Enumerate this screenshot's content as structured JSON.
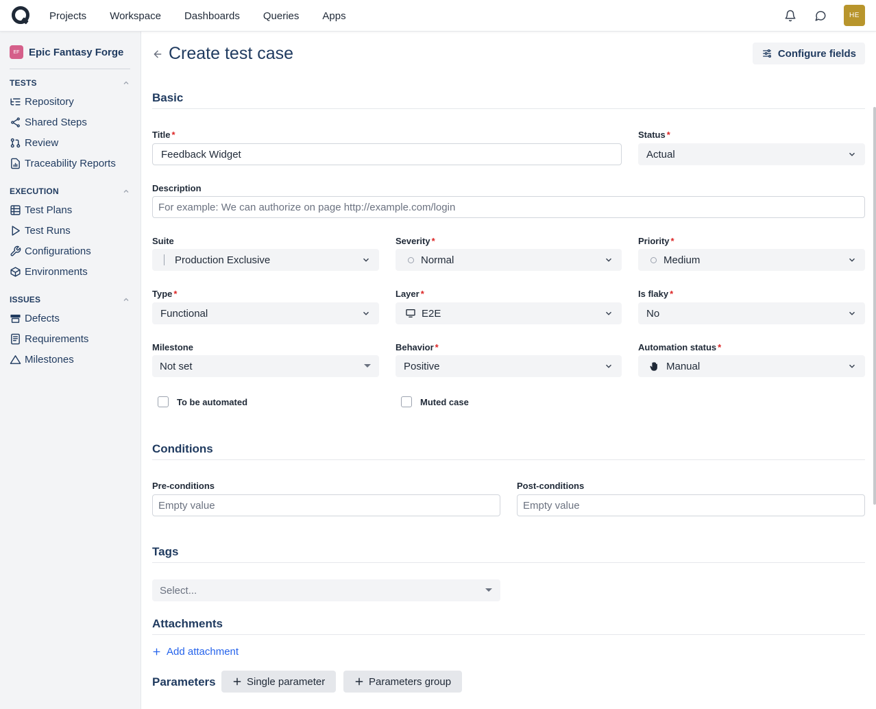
{
  "topnav": {
    "links": [
      "Projects",
      "Workspace",
      "Dashboards",
      "Queries",
      "Apps"
    ],
    "avatar_initials": "HE",
    "icons": [
      "bell-icon",
      "chat-icon"
    ]
  },
  "sidebar": {
    "project": {
      "badge": "EF",
      "name": "Epic Fantasy Forge"
    },
    "sections": [
      {
        "title": "TESTS",
        "items": [
          "Repository",
          "Shared Steps",
          "Review",
          "Traceability Reports"
        ]
      },
      {
        "title": "EXECUTION",
        "items": [
          "Test Plans",
          "Test Runs",
          "Configurations",
          "Environments"
        ]
      },
      {
        "title": "ISSUES",
        "items": [
          "Defects",
          "Requirements",
          "Milestones"
        ]
      }
    ]
  },
  "page": {
    "title": "Create test case",
    "configure_label": "Configure fields"
  },
  "basic": {
    "section": "Basic",
    "title_label": "Title",
    "title_value": "Feedback Widget",
    "status_label": "Status",
    "status_value": "Actual",
    "description_label": "Description",
    "description_placeholder": "For example: We can authorize on page http://example.com/login",
    "suite_label": "Suite",
    "suite_value": "Production Exclusive",
    "severity_label": "Severity",
    "severity_value": "Normal",
    "priority_label": "Priority",
    "priority_value": "Medium",
    "type_label": "Type",
    "type_value": "Functional",
    "layer_label": "Layer",
    "layer_value": "E2E",
    "flaky_label": "Is flaky",
    "flaky_value": "No",
    "milestone_label": "Milestone",
    "milestone_value": "Not set",
    "behavior_label": "Behavior",
    "behavior_value": "Positive",
    "automation_label": "Automation status",
    "automation_value": "Manual",
    "to_be_automated": "To be automated",
    "muted_case": "Muted case",
    "required_mark": "*"
  },
  "conditions": {
    "section": "Conditions",
    "pre_label": "Pre-conditions",
    "pre_placeholder": "Empty value",
    "post_label": "Post-conditions",
    "post_placeholder": "Empty value"
  },
  "tags": {
    "section": "Tags",
    "placeholder": "Select..."
  },
  "attachments": {
    "section": "Attachments",
    "add_label": "Add attachment"
  },
  "parameters": {
    "section": "Parameters",
    "single_label": "Single parameter",
    "group_label": "Parameters group"
  },
  "colors": {
    "accent": "#2563eb",
    "heading": "#1f3a5f",
    "required": "#dc2626",
    "avatar": "#b8952c",
    "project_badge": "#d55f8a"
  }
}
